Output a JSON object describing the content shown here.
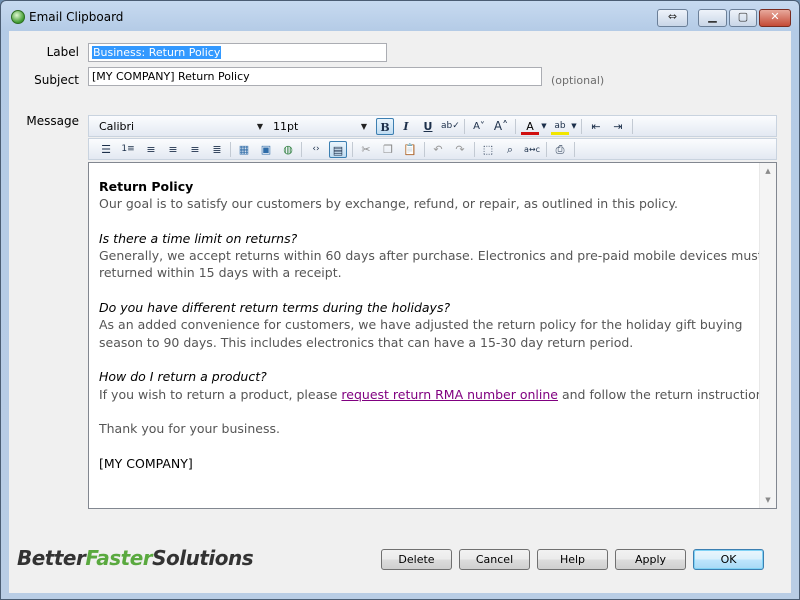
{
  "window": {
    "title": "Email Clipboard"
  },
  "form": {
    "label_caption": "Label",
    "label_value": "Business: Return Policy",
    "subject_caption": "Subject",
    "subject_value": "[MY COMPANY] Return Policy",
    "optional_note": "(optional)",
    "message_caption": "Message"
  },
  "toolbar": {
    "font": "Calibri",
    "size": "11pt",
    "bold": "B",
    "italic": "I",
    "underline": "U"
  },
  "message": {
    "heading": "Return Policy",
    "intro": "Our goal is to satisfy our customers by exchange, refund, or repair, as outlined in this policy.",
    "q1": "Is there a time limit on returns?",
    "a1_line1": "Generally, we accept returns within 60 days after purchase. Electronics and pre-paid mobile devices must be",
    "a1_line2": "returned within 15 days with a receipt.",
    "q2": "Do you have different return terms during the holidays?",
    "a2_line1": "As an added convenience for customers, we have adjusted the return policy for the holiday gift buying",
    "a2_line2": "season to 90 days. This includes electronics that can have a 15-30 day return period.",
    "q3": "How do I return a product?",
    "a3_prefix": "If you wish to return a product, please ",
    "a3_link": "request return RMA number online",
    "a3_suffix": " and follow the return instructions.",
    "thanks": "Thank you for your business.",
    "signature": "[MY COMPANY]"
  },
  "logo": {
    "part1": "Better",
    "part2": "Faster",
    "part3": "Solutions"
  },
  "buttons": {
    "delete": "Delete",
    "cancel": "Cancel",
    "help": "Help",
    "apply": "Apply",
    "ok": "OK"
  },
  "colors": {
    "link": "#800080",
    "logo_green": "#5aa93f",
    "selection": "#3399ff"
  }
}
